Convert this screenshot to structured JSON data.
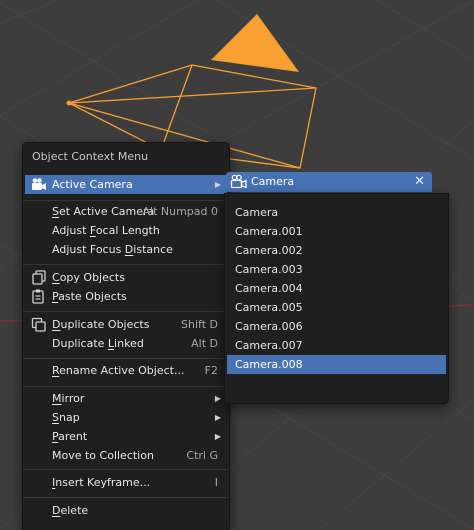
{
  "context_menu": {
    "title": "Object Context Menu",
    "active_camera": {
      "label": "Active Camera",
      "icon": "camera-icon"
    },
    "set_active_camera": {
      "mnemonic": "S",
      "rest": "et Active Camera",
      "shortcut": "Alt Numpad 0"
    },
    "adjust_focal_length": {
      "before": "Adjust ",
      "mnemonic": "F",
      "after": "ocal Length"
    },
    "adjust_focus_distance": {
      "before": "Adjust Focus ",
      "mnemonic": "D",
      "after": "istance"
    },
    "copy_objects": {
      "mnemonic": "C",
      "rest": "opy Objects",
      "icon": "copy-icon"
    },
    "paste_objects": {
      "mnemonic": "P",
      "rest": "aste Objects",
      "icon": "paste-icon"
    },
    "duplicate_objects": {
      "mnemonic": "D",
      "rest": "uplicate Objects",
      "shortcut": "Shift D",
      "icon": "duplicate-icon"
    },
    "duplicate_linked": {
      "before": "Duplicate ",
      "mnemonic": "L",
      "after": "inked",
      "shortcut": "Alt D"
    },
    "rename": {
      "mnemonic": "R",
      "rest": "ename Active Object...",
      "shortcut": "F2"
    },
    "mirror": {
      "mnemonic": "M",
      "rest": "irror"
    },
    "snap": {
      "mnemonic": "S",
      "rest": "nap"
    },
    "parent": {
      "mnemonic": "P",
      "rest": "arent"
    },
    "move_to_collection": {
      "label": "Move to Collection",
      "shortcut": "Ctrl G"
    },
    "insert_keyframe": {
      "mnemonic": "I",
      "rest": "nsert Keyframe...",
      "shortcut": "I"
    },
    "delete": {
      "mnemonic": "D",
      "rest": "elete"
    }
  },
  "camera_submenu": {
    "header": {
      "label": "Camera",
      "close": "✕",
      "icon": "camera-icon"
    },
    "items": [
      "Camera",
      "Camera.001",
      "Camera.002",
      "Camera.003",
      "Camera.004",
      "Camera.005",
      "Camera.006",
      "Camera.007",
      "Camera.008"
    ],
    "selected": "Camera.008"
  },
  "colors": {
    "viewport_bg": "#3d3d3d",
    "menu_bg": "#1f1f1f",
    "highlight": "#4772b3",
    "camera_wire": "#f5a031"
  }
}
